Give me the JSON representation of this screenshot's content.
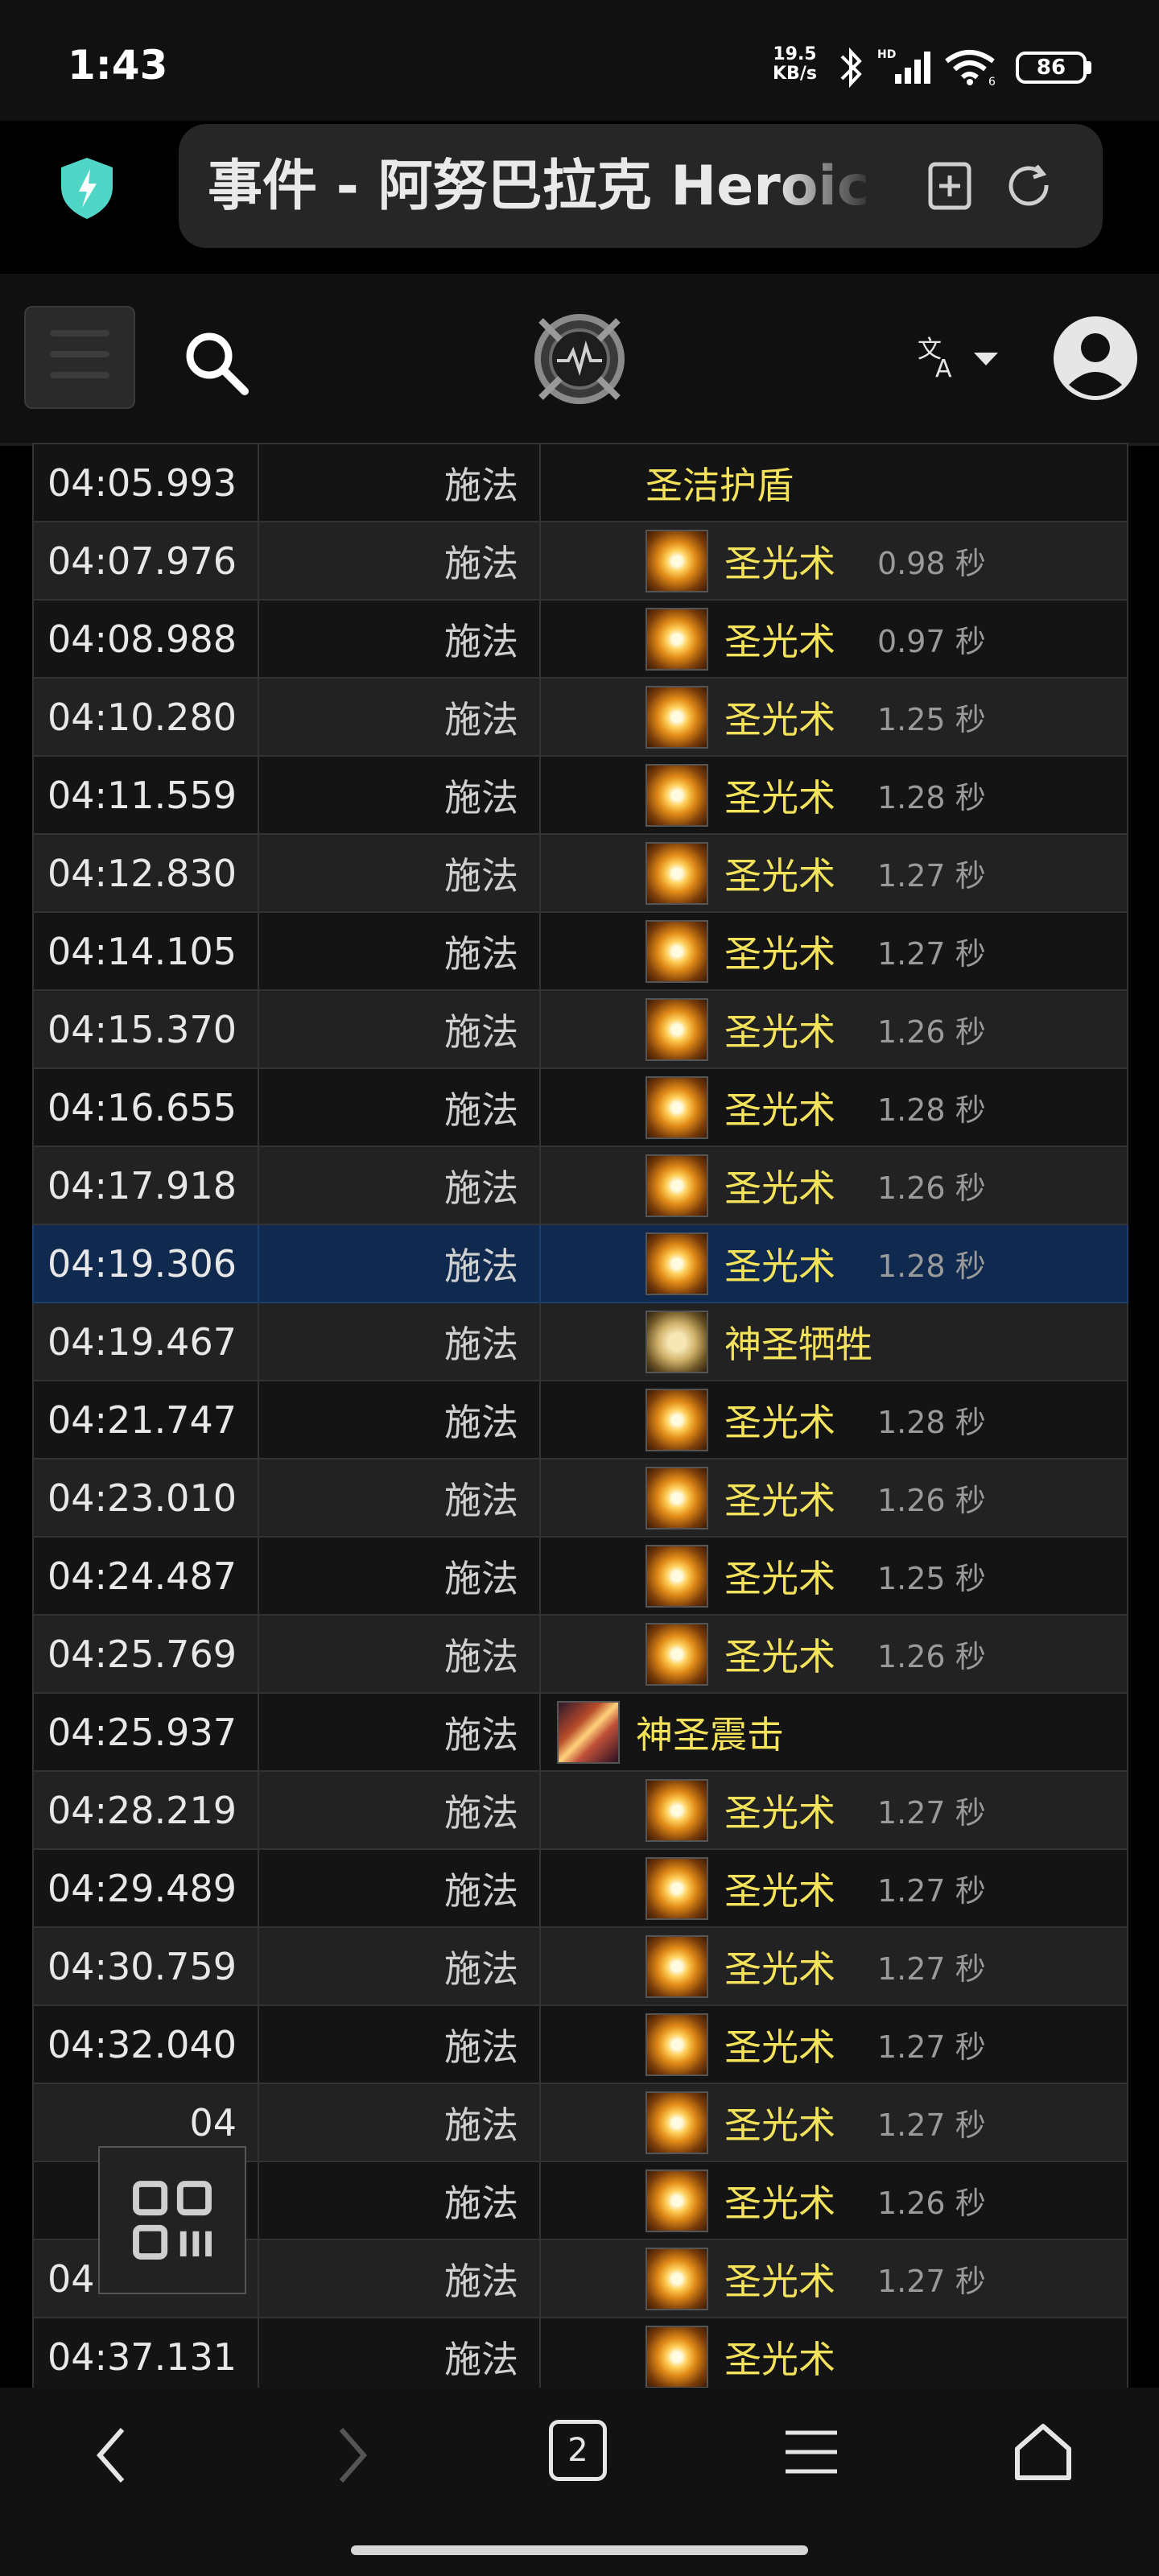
{
  "status_bar": {
    "time": "1:43",
    "net_speed_value": "19.5",
    "net_speed_unit": "KB/s",
    "battery": "86",
    "icons": [
      "bluetooth-icon",
      "hd-signal-icon",
      "wifi-icon",
      "battery-icon"
    ]
  },
  "browser": {
    "page_title": "事件 - 阿努巴拉克 Heroic",
    "open_tabs": "2"
  },
  "site_header": {
    "icons": [
      "menu-icon",
      "search-icon",
      "site-logo",
      "translate-icon",
      "user-icon"
    ]
  },
  "events": {
    "rows": [
      {
        "time": "04:05.993",
        "type": "施法",
        "ability": "圣洁护盾",
        "cast": "",
        "icon": "shield",
        "indent": true
      },
      {
        "time": "04:07.976",
        "type": "施法",
        "ability": "圣光术",
        "cast": "0.98 秒",
        "icon": "holylight",
        "indent": true
      },
      {
        "time": "04:08.988",
        "type": "施法",
        "ability": "圣光术",
        "cast": "0.97 秒",
        "icon": "holylight",
        "indent": true
      },
      {
        "time": "04:10.280",
        "type": "施法",
        "ability": "圣光术",
        "cast": "1.25 秒",
        "icon": "holylight",
        "indent": true
      },
      {
        "time": "04:11.559",
        "type": "施法",
        "ability": "圣光术",
        "cast": "1.28 秒",
        "icon": "holylight",
        "indent": true
      },
      {
        "time": "04:12.830",
        "type": "施法",
        "ability": "圣光术",
        "cast": "1.27 秒",
        "icon": "holylight",
        "indent": true
      },
      {
        "time": "04:14.105",
        "type": "施法",
        "ability": "圣光术",
        "cast": "1.27 秒",
        "icon": "holylight",
        "indent": true
      },
      {
        "time": "04:15.370",
        "type": "施法",
        "ability": "圣光术",
        "cast": "1.26 秒",
        "icon": "holylight",
        "indent": true
      },
      {
        "time": "04:16.655",
        "type": "施法",
        "ability": "圣光术",
        "cast": "1.28 秒",
        "icon": "holylight",
        "indent": true
      },
      {
        "time": "04:17.918",
        "type": "施法",
        "ability": "圣光术",
        "cast": "1.26 秒",
        "icon": "holylight",
        "indent": true
      },
      {
        "time": "04:19.306",
        "type": "施法",
        "ability": "圣光术",
        "cast": "1.28 秒",
        "icon": "holylight",
        "indent": true,
        "selected": true
      },
      {
        "time": "04:19.467",
        "type": "施法",
        "ability": "神圣牺牲",
        "cast": "",
        "icon": "sacrifice",
        "indent": true
      },
      {
        "time": "04:21.747",
        "type": "施法",
        "ability": "圣光术",
        "cast": "1.28 秒",
        "icon": "holylight",
        "indent": true
      },
      {
        "time": "04:23.010",
        "type": "施法",
        "ability": "圣光术",
        "cast": "1.26 秒",
        "icon": "holylight",
        "indent": true
      },
      {
        "time": "04:24.487",
        "type": "施法",
        "ability": "圣光术",
        "cast": "1.25 秒",
        "icon": "holylight",
        "indent": true
      },
      {
        "time": "04:25.769",
        "type": "施法",
        "ability": "圣光术",
        "cast": "1.26 秒",
        "icon": "holylight",
        "indent": true
      },
      {
        "time": "04:25.937",
        "type": "施法",
        "ability": "神圣震击",
        "cast": "",
        "icon": "shock",
        "indent": false
      },
      {
        "time": "04:28.219",
        "type": "施法",
        "ability": "圣光术",
        "cast": "1.27 秒",
        "icon": "holylight",
        "indent": true
      },
      {
        "time": "04:29.489",
        "type": "施法",
        "ability": "圣光术",
        "cast": "1.27 秒",
        "icon": "holylight",
        "indent": true
      },
      {
        "time": "04:30.759",
        "type": "施法",
        "ability": "圣光术",
        "cast": "1.27 秒",
        "icon": "holylight",
        "indent": true
      },
      {
        "time": "04:32.040",
        "type": "施法",
        "ability": "圣光术",
        "cast": "1.27 秒",
        "icon": "holylight",
        "indent": true
      },
      {
        "time": "04",
        "type": "施法",
        "ability": "圣光术",
        "cast": "1.27 秒",
        "icon": "holylight",
        "indent": true
      },
      {
        "time": "04",
        "type": "施法",
        "ability": "圣光术",
        "cast": "1.26 秒",
        "icon": "holylight",
        "indent": true
      },
      {
        "time": "04:35.845",
        "type": "施法",
        "ability": "圣光术",
        "cast": "1.27 秒",
        "icon": "holylight",
        "indent": true
      },
      {
        "time": "04:37.131",
        "type": "施法",
        "ability": "圣光术",
        "cast": "",
        "icon": "holylight",
        "indent": true
      }
    ]
  },
  "colors": {
    "ability_name": "#f4e35a",
    "selected_row": "#0f2a4e",
    "row_odd": "#141414",
    "row_even": "#222222"
  }
}
